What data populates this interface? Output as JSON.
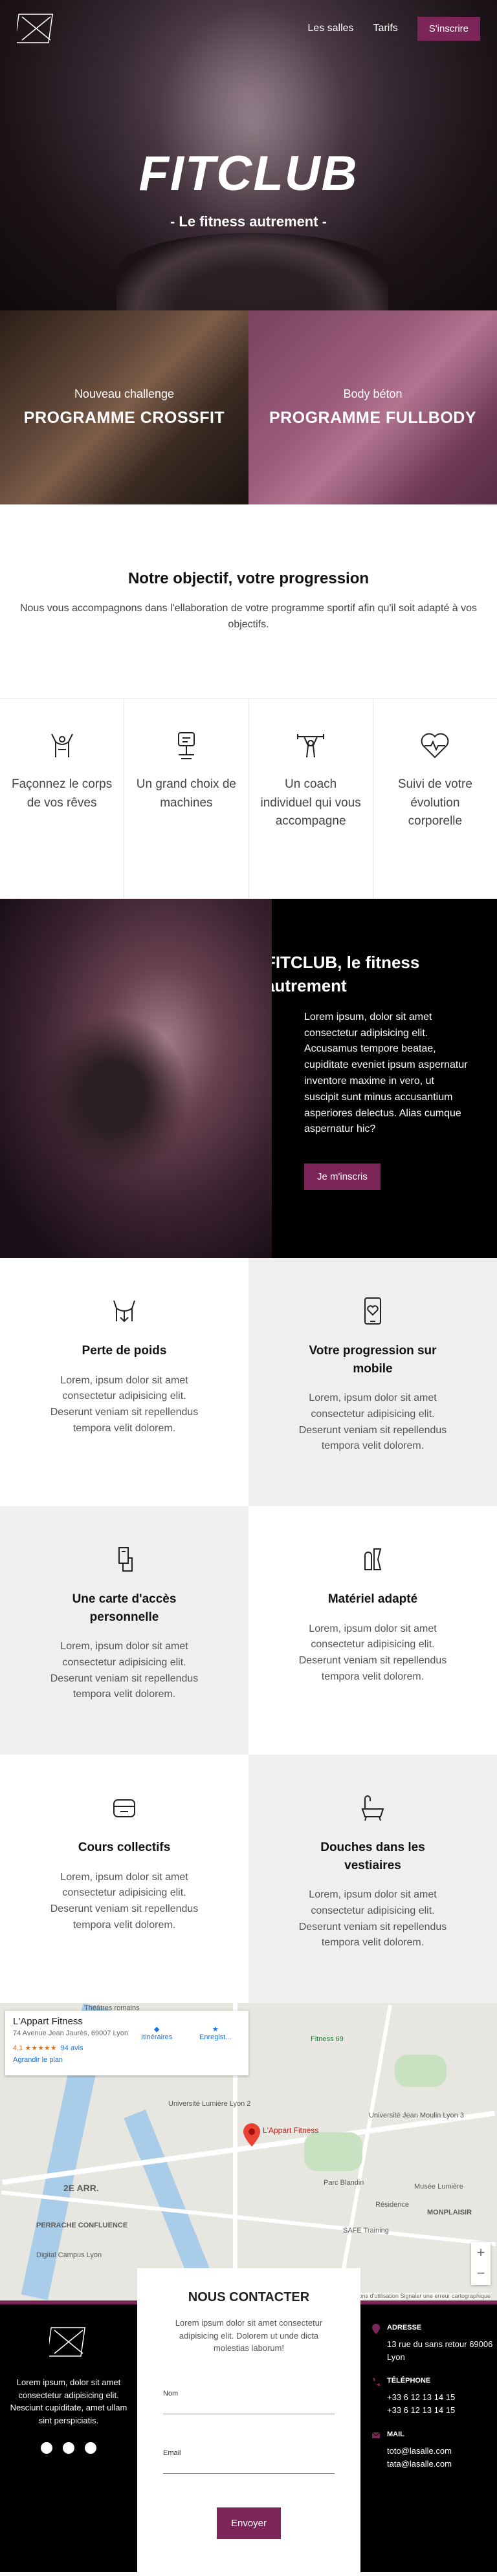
{
  "nav": {
    "links": [
      "Les salles",
      "Tarifs"
    ],
    "cta": "S'inscrire"
  },
  "hero": {
    "title": "FITCLUB",
    "subtitle": "- Le fitness autrement -"
  },
  "programs": [
    {
      "kicker": "Nouveau challenge",
      "title": "PROGRAMME CROSSFIT"
    },
    {
      "kicker": "Body béton",
      "title": "PROGRAMME FULLBODY"
    }
  ],
  "objectif": {
    "title": "Notre objectif, votre progression",
    "text": "Nous vous accompagnons dans l'ellaboration de votre programme sportif afin qu'il soit adapté à vos objectifs."
  },
  "features": [
    {
      "icon": "body-icon",
      "label": "Façonnez le corps de vos rêves"
    },
    {
      "icon": "machine-icon",
      "label": "Un grand choix de machines"
    },
    {
      "icon": "coach-icon",
      "label": "Un coach individuel qui vous accompagne"
    },
    {
      "icon": "heartbeat-icon",
      "label": "Suivi de votre évolution corporelle"
    }
  ],
  "about": {
    "title": "FITCLUB, le fitness autrement",
    "text": "Lorem ipsum, dolor sit amet consectetur adipisicing elit. Accusamus tempore beatae, cupiditate eveniet ipsum aspernatur inventore maxime in vero, ut suscipit sunt minus accusantium asperiores delectus. Alias cumque aspernatur hic?",
    "cta": "Je m'inscris"
  },
  "benefits": [
    {
      "icon": "weight-loss-icon",
      "title": "Perte de poids",
      "text": "Lorem, ipsum dolor sit amet consectetur adipisicing elit. Deserunt veniam sit repellendus tempora velit dolorem."
    },
    {
      "icon": "phone-progress-icon",
      "title": "Votre progression sur mobile",
      "text": "Lorem, ipsum dolor sit amet consectetur adipisicing elit. Deserunt veniam sit repellendus tempora velit dolorem."
    },
    {
      "icon": "access-card-icon",
      "title": "Une carte d'accès personnelle",
      "text": "Lorem, ipsum dolor sit amet consectetur adipisicing elit. Deserunt veniam sit repellendus tempora velit dolorem."
    },
    {
      "icon": "equipment-icon",
      "title": "Matériel adapté",
      "text": "Lorem, ipsum dolor sit amet consectetur adipisicing elit. Deserunt veniam sit repellendus tempora velit dolorem."
    },
    {
      "icon": "group-class-icon",
      "title": "Cours collectifs",
      "text": "Lorem, ipsum dolor sit amet consectetur adipisicing elit. Deserunt veniam sit repellendus tempora velit dolorem."
    },
    {
      "icon": "shower-icon",
      "title": "Douches dans les vestiaires",
      "text": "Lorem, ipsum dolor sit amet consectetur adipisicing elit. Deserunt veniam sit repellendus tempora velit dolorem."
    }
  ],
  "map": {
    "place_name": "L'Appart Fitness",
    "address": "74 Avenue Jean Jaurès, 69007 Lyon",
    "rating": "4,1 ★★★★★",
    "reviews": "94 avis",
    "enlarge": "Agrandir le plan",
    "directions": "Itinéraires",
    "save": "Enregist...",
    "pin_label": "L'Appart Fitness",
    "labels": [
      "Théâtres romains",
      "Fitness 69",
      "Université Lumière Lyon 2",
      "Université Jean Moulin Lyon 3",
      "Parc Blandin",
      "2E ARR.",
      "PERRACHE CONFLUENCE",
      "Musée Lumière",
      "MONPLAISIR",
      "Résidence",
      "SAFE Training",
      "Digital Campus Lyon"
    ],
    "attribution": "Raccourcis clavier  Données cartographiques ©2022  Conditions d'utilisation  Signaler une erreur cartographique"
  },
  "footer": {
    "text": "Lorem ipsum, dolor sit amet consectetur adipisicing elit. Nesciunt cupiditate, amet ullam sint perspiciatis.",
    "contact": {
      "title": "NOUS CONTACTER",
      "text": "Lorem ipsum dolor sit amet consectetur adipisicing elit. Dolorem ut unde dicta molestias laborum!",
      "name_label": "Nom",
      "email_label": "Email",
      "submit": "Envoyer"
    },
    "address_label": "ADRESSE",
    "address": "13 rue du sans retour 69006 Lyon",
    "phone_label": "TÉLÉPHONE",
    "phone1": "+33 6 12 13 14 15",
    "phone2": "+33 6 12 13 14 15",
    "mail_label": "MAIL",
    "mail1": "toto@lasalle.com",
    "mail2": "tata@lasalle.com"
  },
  "colors": {
    "accent": "#7c2558"
  }
}
